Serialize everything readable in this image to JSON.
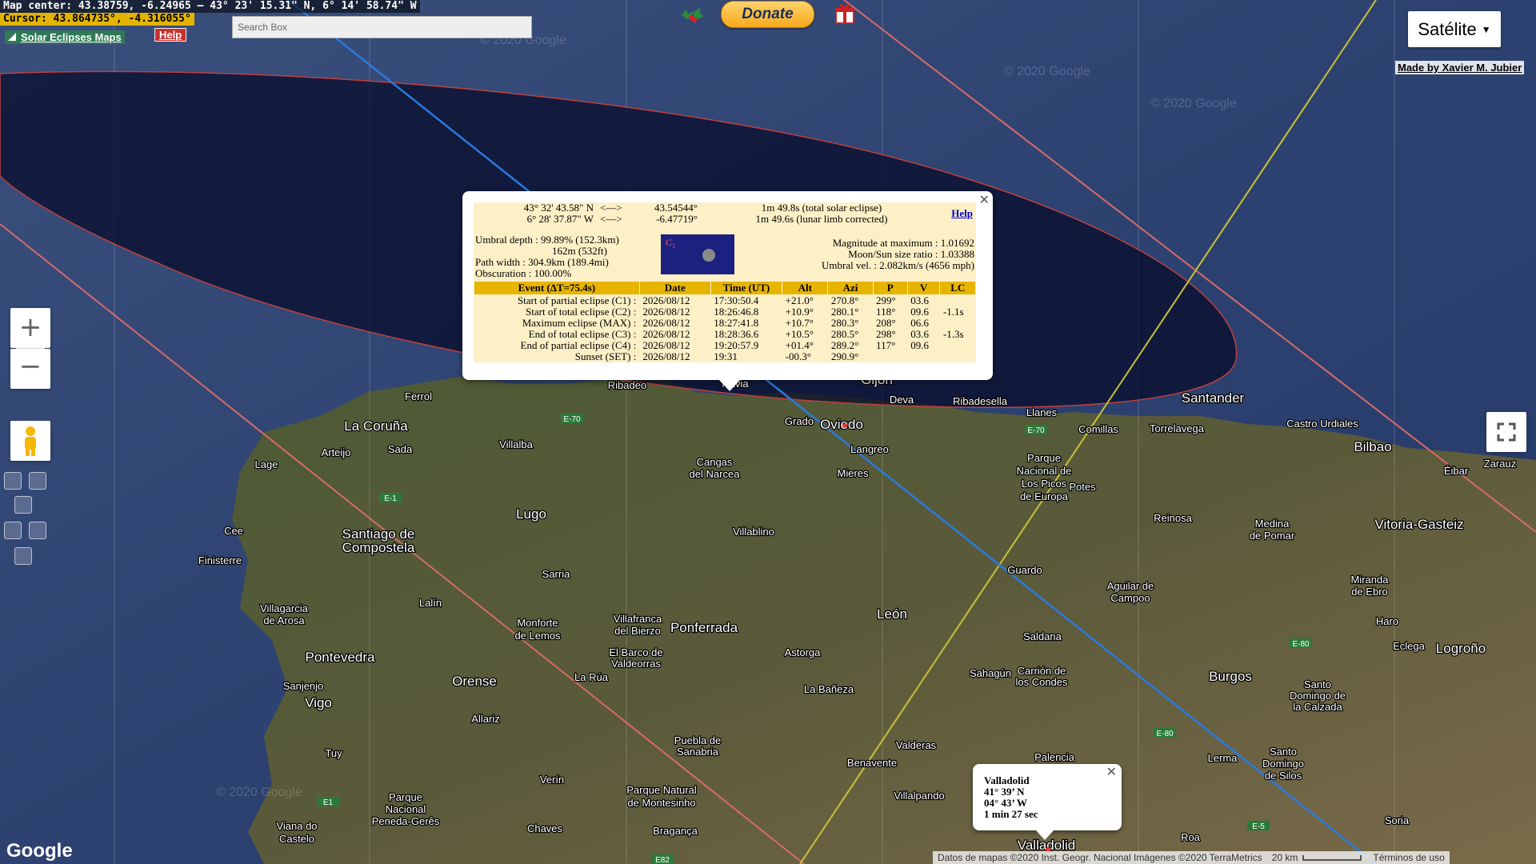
{
  "status": {
    "map_center": "Map center: 43.38759, -6.24965 — 43° 23' 15.31\" N, 6° 14' 58.74\" W",
    "cursor": "Cursor: 43.864735°, -4.316055°"
  },
  "toolbar": {
    "site_link": "Solar Eclipses Maps",
    "help": "Help",
    "search_placeholder": "Search Box",
    "donate": "Donate"
  },
  "map_type": {
    "label": "Satélite"
  },
  "credit": "Made by Xavier M. Jubier",
  "map_labels": {
    "watermark": "© 2020 Google",
    "towns": [
      "Ferrol",
      "La Coruña",
      "Arteijo",
      "Sada",
      "Villalba",
      "Lage",
      "Lugo",
      "Cee",
      "Finisterre",
      "Santiago de",
      "Compostela",
      "Sarria",
      "Lalín",
      "Villagarcia",
      "de Arosa",
      "Pontevedra",
      "Sanjenjo",
      "Vigo",
      "Orense",
      "Monforte",
      "de Lemos",
      "Villafranca",
      "del Bierzo",
      "Ponferrada",
      "El Barco de",
      "Valdeorras",
      "La Rúa",
      "Allariz",
      "Tuy",
      "Verín",
      "Parque Natural",
      "de Montesinho",
      "Bragança",
      "Chaves",
      "Parque",
      "Nacional",
      "Peneda-Gerês",
      "Viana do",
      "Castelo",
      "Puebla de",
      "Sanabria",
      "Astorga",
      "La Bañeza",
      "Benavente",
      "Valderas",
      "Villalpando",
      "León",
      "Sahagún",
      "Saldana",
      "Carrión de",
      "los Condes",
      "Burgos",
      "Lerma",
      "Santo",
      "Domingo",
      "de Silos",
      "Aguilar de",
      "Campoo",
      "Reinosa",
      "Medina",
      "de Pomar",
      "Vitoria-Gasteiz",
      "Miranda",
      "de Ebro",
      "Haro",
      "Eclega",
      "Logroño",
      "Santo",
      "Domingo de",
      "la Calzada",
      "Soria",
      "Roa",
      "Palencia",
      "Valladolid",
      "Guardo",
      "Villablino",
      "Cangas",
      "del Narcea",
      "Mieres",
      "Langreo",
      "Oviedo",
      "Grado",
      "Gijón",
      "Navia",
      "Ribadeo",
      "Deva",
      "Ribadesella",
      "Llanes",
      "Parque",
      "Nacional de",
      "Los Picos",
      "de Europa",
      "Potes",
      "Comillas",
      "Torrelavega",
      "Santander",
      "Castro Urdiales",
      "Bilbao",
      "Éibar",
      "Zarauz"
    ],
    "roads": [
      "E-70",
      "E-70",
      "E-1",
      "E1",
      "E-80",
      "E-80",
      "E-5",
      "E82"
    ]
  },
  "eclipse_info": {
    "lat_dms": "43° 32' 43.58\" N",
    "lon_dms": "6° 28' 37.87\" W",
    "arrow": "<—>",
    "lat_dec": "43.54544°",
    "lon_dec": "-6.47719°",
    "duration": "1m 49.8s (total solar eclipse)",
    "duration_corr": "1m 49.6s (lunar limb corrected)",
    "help": "Help",
    "umbral_depth": "Umbral depth : 99.89% (152.3km)",
    "altitude": "162m (532ft)",
    "path_width": "Path width : 304.9km (189.4mi)",
    "obscuration": "Obscuration : 100.00%",
    "thumb_label": "C₂",
    "magnitude": "Magnitude at maximum : 1.01692",
    "moon_sun_ratio": "Moon/Sun size ratio : 1.03388",
    "umbral_vel": "Umbral vel. : 2.082km/s (4656 mph)",
    "headers": [
      "Event (ΔT=75.4s)",
      "Date",
      "Time (UT)",
      "Alt",
      "Azi",
      "P",
      "V",
      "LC"
    ],
    "rows": [
      [
        "Start of partial eclipse (C1) :",
        "2026/08/12",
        "17:30:50.4",
        "+21.0°",
        "270.8°",
        "299°",
        "03.6",
        ""
      ],
      [
        "Start of total eclipse (C2) :",
        "2026/08/12",
        "18:26:46.8",
        "+10.9°",
        "280.1°",
        "118°",
        "09.6",
        "-1.1s"
      ],
      [
        "Maximum eclipse (MAX) :",
        "2026/08/12",
        "18:27:41.8",
        "+10.7°",
        "280.3°",
        "208°",
        "06.6",
        ""
      ],
      [
        "End of total eclipse (C3) :",
        "2026/08/12",
        "18:28:36.6",
        "+10.5°",
        "280.5°",
        "298°",
        "03.6",
        "-1.3s"
      ],
      [
        "End of partial eclipse (C4) :",
        "2026/08/12",
        "19:20:57.9",
        "+01.4°",
        "289.2°",
        "117°",
        "09.6",
        ""
      ],
      [
        "Sunset (SET) :",
        "2026/08/12",
        "19:31",
        "-00.3°",
        "290.9°",
        "",
        "",
        ""
      ]
    ]
  },
  "city_popup": {
    "name": "Valladolid",
    "lat": "41° 39’ N",
    "lon": "04° 43’ W",
    "duration": "1 min 27 sec"
  },
  "footer": {
    "google": "Google",
    "attribution": "Datos de mapas ©2020 Inst. Geogr. Nacional Imágenes ©2020 TerraMetrics",
    "scale": "20 km",
    "terms": "Términos de uso"
  },
  "colors": {
    "umbra": "#0a1233",
    "center_line": "#2a7ae0",
    "limit_line": "#d86a6a",
    "path_line": "#c9c23a",
    "table_header": "#e7b400"
  }
}
